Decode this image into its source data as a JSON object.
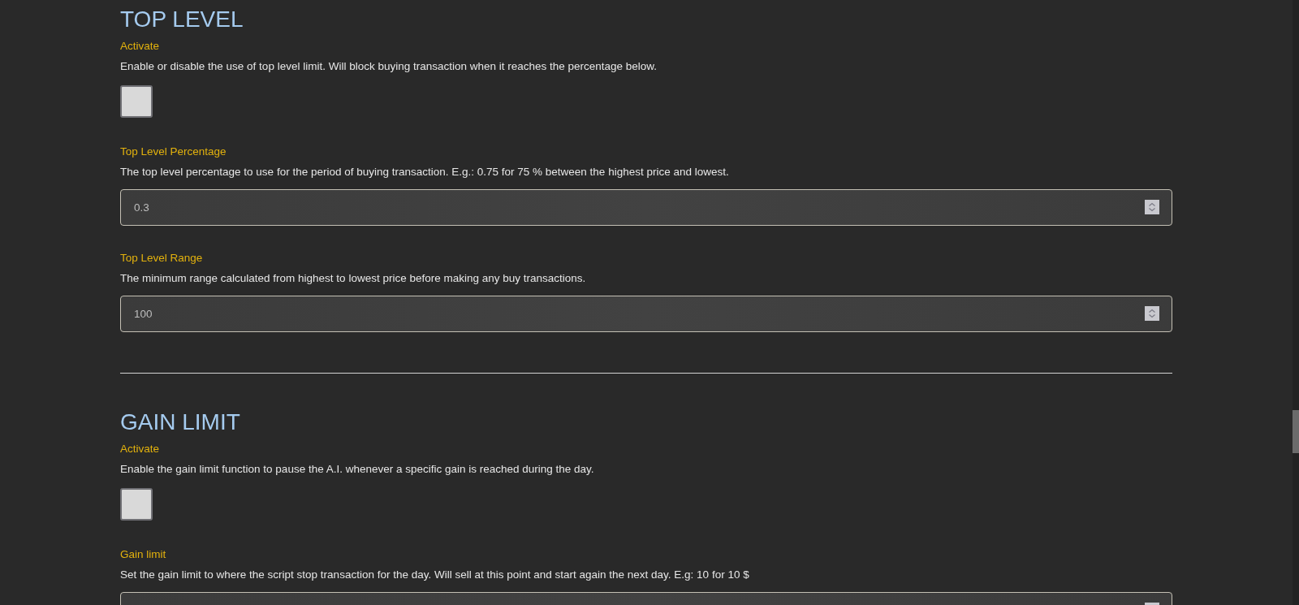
{
  "sections": [
    {
      "title": "TOP LEVEL",
      "settings": [
        {
          "kind": "checkbox",
          "label": "Activate",
          "description": "Enable or disable the use of top level limit. Will block buying transaction when it reaches the percentage below.",
          "checked": false
        },
        {
          "kind": "number",
          "label": "Top Level Percentage",
          "description": "The top level percentage to use for the period of buying transaction. E.g.: 0.75 for 75 % between the highest price and lowest.",
          "value": "0.3"
        },
        {
          "kind": "number",
          "label": "Top Level Range",
          "description": "The minimum range calculated from highest to lowest price before making any buy transactions.",
          "value": "100"
        }
      ]
    },
    {
      "title": "GAIN LIMIT",
      "settings": [
        {
          "kind": "checkbox",
          "label": "Activate",
          "description": "Enable the gain limit function to pause the A.I. whenever a specific gain is reached during the day.",
          "checked": false
        },
        {
          "kind": "number",
          "label": "Gain limit",
          "description": "Set the gain limit to where the script stop transaction for the day. Will sell at this point and start again the next day. E.g: 10 for 10 $"
        }
      ]
    }
  ]
}
